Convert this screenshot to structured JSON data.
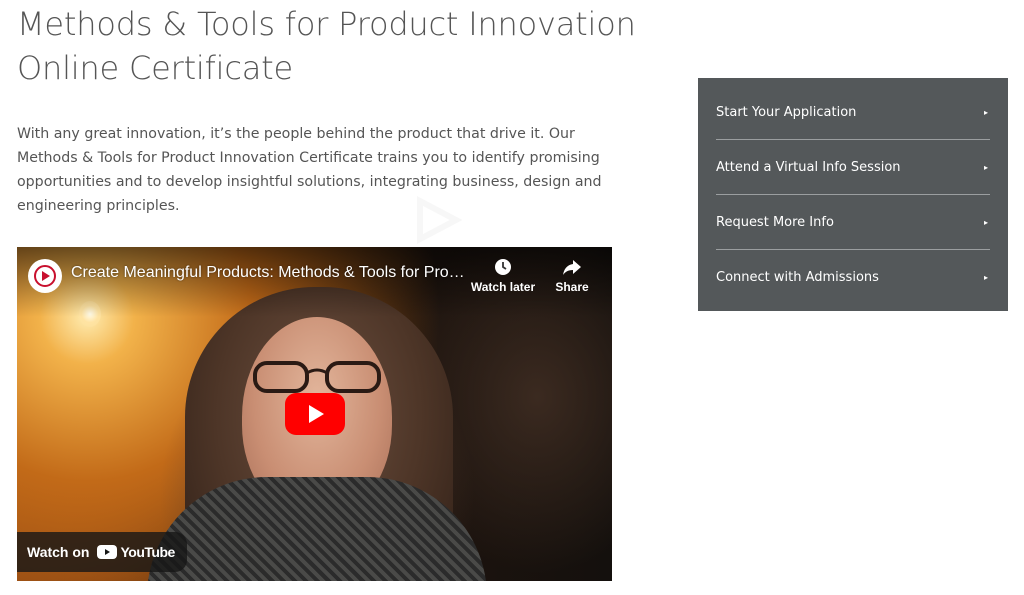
{
  "page": {
    "title_lines": [
      "Methods & Tools for Product Innovation",
      "Online Certificate"
    ],
    "intro": "With any great innovation, it’s the people behind the product that drive it. Our Methods & Tools for Product Innovation Certificate trains you to identify promising opportunities and to develop insightful solutions, integrating business, design and engineering principles."
  },
  "video": {
    "title": "Create Meaningful Products: Methods & Tools for Prod…",
    "watch_later_label": "Watch later",
    "share_label": "Share",
    "watch_on_label": "Watch on",
    "youtube_label": "YouTube",
    "icons": {
      "channel": "channel-logo-icon",
      "watch_later": "clock-icon",
      "share": "share-arrow-icon",
      "play": "play-icon"
    }
  },
  "sidebar": {
    "items": [
      {
        "label": "Start Your Application",
        "arrow": "▸"
      },
      {
        "label": "Attend a Virtual Info Session",
        "arrow": "▸"
      },
      {
        "label": "Request More Info",
        "arrow": "▸"
      },
      {
        "label": "Connect with Admissions",
        "arrow": "▸"
      }
    ]
  },
  "colors": {
    "panel_bg": "#54585a",
    "text": "#555555",
    "youtube_red": "#ff0000",
    "brand_red": "#c8102e"
  }
}
